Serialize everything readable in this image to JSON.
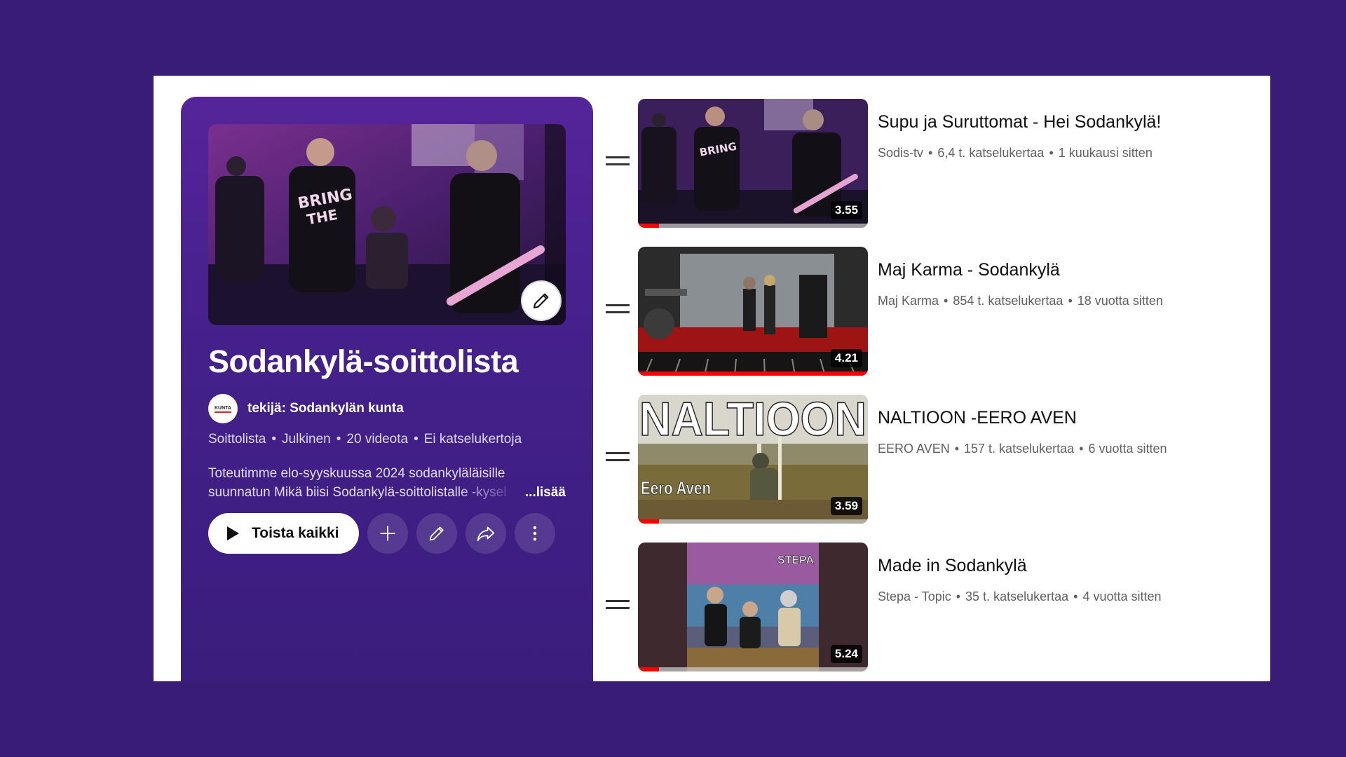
{
  "playlist": {
    "title": "Sodankylä-soittolista",
    "owner": "tekijä: Sodankylän kunta",
    "avatar_text": "KUNTA",
    "meta": [
      "Soittolista",
      "Julkinen",
      "20 videota",
      "Ei katselukertoja"
    ],
    "description_line1": "Toteutimme elo-syyskuussa 2024 sodankyläläisille",
    "description_line2": "suunnatun Mikä biisi Sodankylä-soittolistalle -kysel",
    "more_label": "...lisää",
    "play_all_label": "Toista kaikki",
    "icons": {
      "edit_thumbnail": "pencil-icon",
      "play": "play-icon",
      "add": "plus-icon",
      "edit": "pencil-icon",
      "share": "share-icon",
      "more": "more-vert-icon"
    }
  },
  "videos": [
    {
      "title": "Supu ja Suruttomat - Hei Sodankylä!",
      "channel": "Sodis-tv",
      "views": "6,4 t. katselukertaa",
      "age": "1 kuukausi sitten",
      "duration": "3.55",
      "progress": 0.09
    },
    {
      "title": "Maj Karma - Sodankylä",
      "channel": "Maj Karma",
      "views": "854 t. katselukertaa",
      "age": "18 vuotta sitten",
      "duration": "4.21",
      "progress": 1.0
    },
    {
      "title": "NALTIOON -EERO AVEN",
      "channel": "EERO AVEN",
      "views": "157 t. katselukertaa",
      "age": "6 vuotta sitten",
      "duration": "3.59",
      "progress": 0.09,
      "thumb_text_big": "NALTIOON",
      "thumb_text_small": "Eero Aven"
    },
    {
      "title": "Made in Sodankylä",
      "channel": "Stepa - Topic",
      "views": "35 t. katselukertaa",
      "age": "4 vuotta sitten",
      "duration": "5.24",
      "progress": 0.09,
      "thumb_text_small": "STEPA"
    }
  ],
  "colors": {
    "background": "#381c75",
    "panel": "#43208a",
    "progress": "#ff0000"
  }
}
